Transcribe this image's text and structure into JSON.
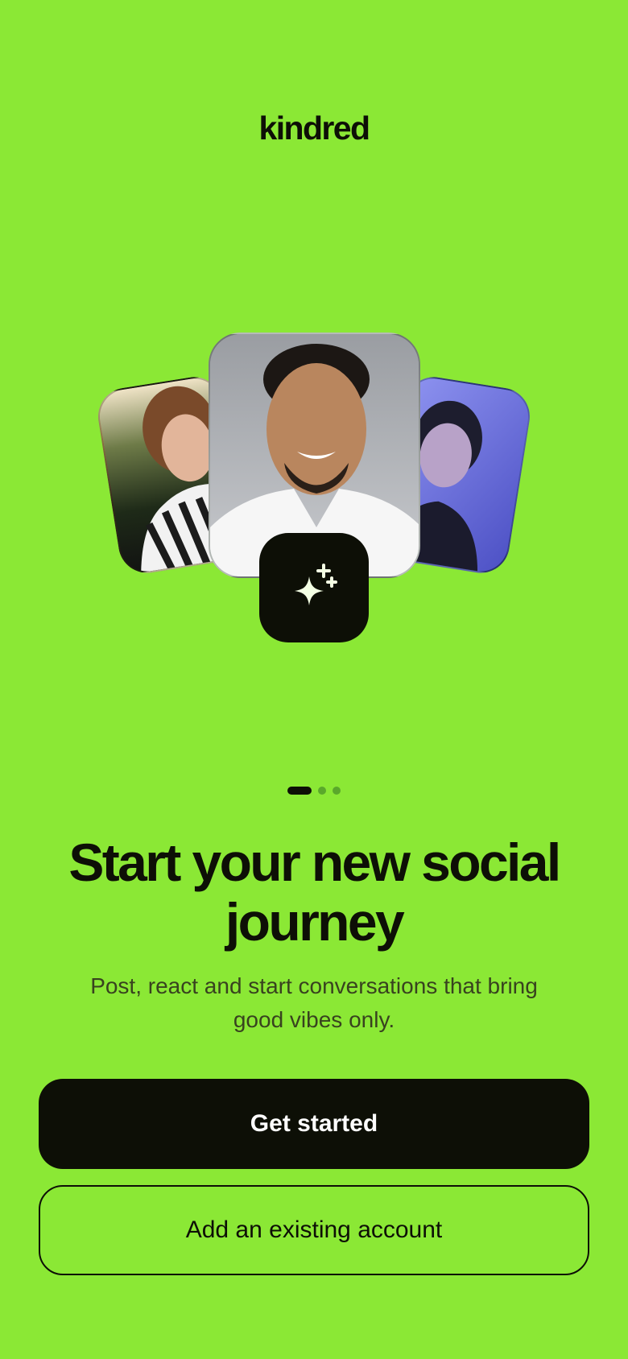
{
  "app": {
    "logo_text": "kindred"
  },
  "hero": {
    "photos": [
      {
        "role": "left",
        "subject": "woman in striped shirt"
      },
      {
        "role": "center",
        "subject": "smiling man in white t-shirt"
      },
      {
        "role": "right",
        "subject": "woman with blue lighting"
      }
    ],
    "badge_icon": "sparkle-icon"
  },
  "pagination": {
    "total": 3,
    "active_index": 0
  },
  "content": {
    "headline": "Start your new social journey",
    "subtext": "Post, react and start conversations that bring good vibes only."
  },
  "actions": {
    "primary_label": "Get started",
    "secondary_label": "Add an existing account"
  },
  "colors": {
    "background": "#8BE835",
    "ink": "#0d0f06",
    "button_text": "#ffffff"
  }
}
